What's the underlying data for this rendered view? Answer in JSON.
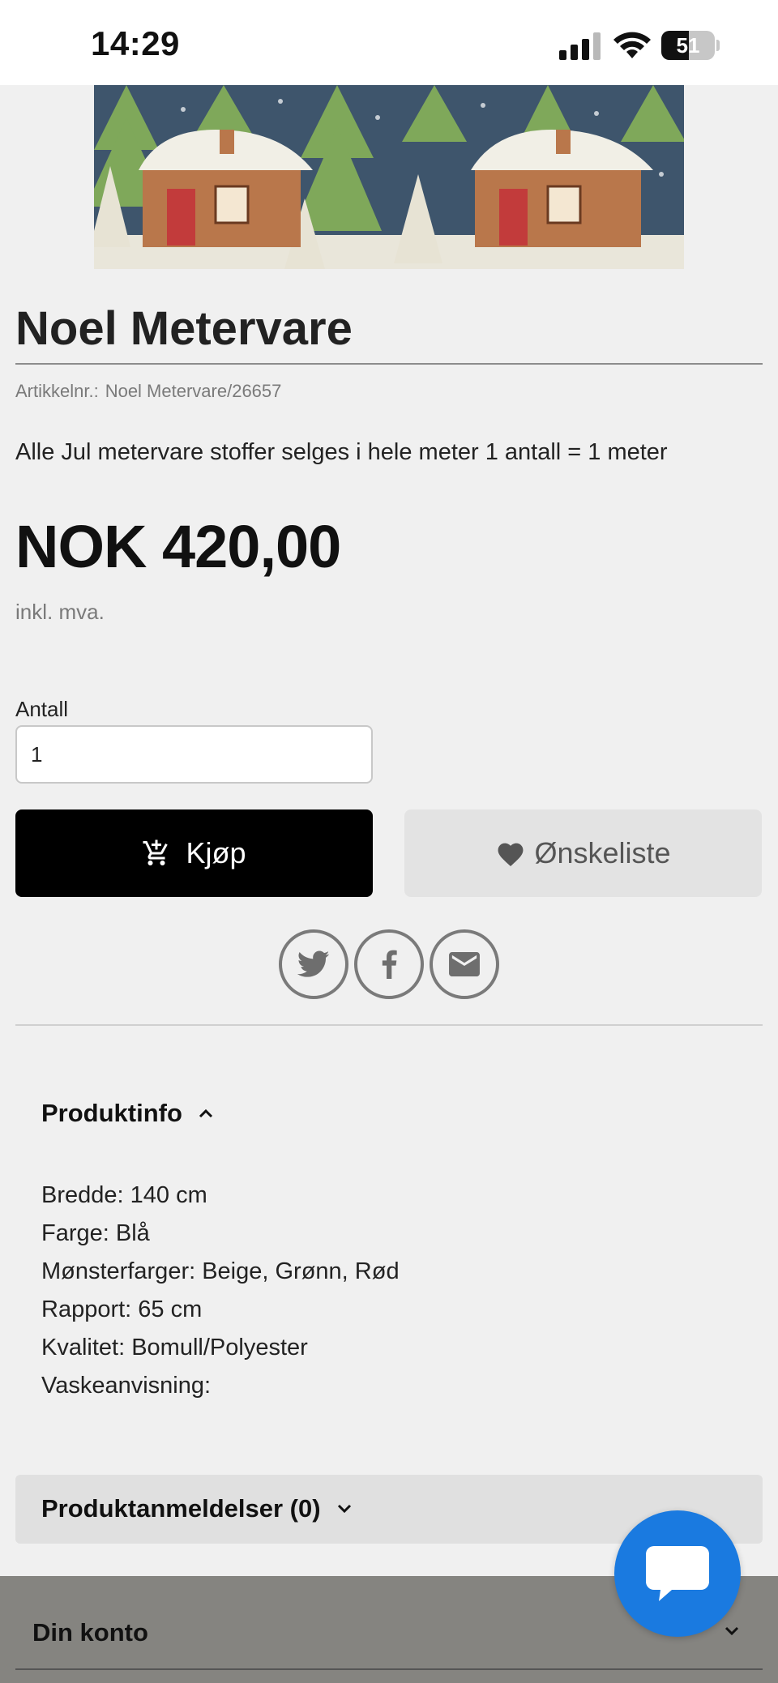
{
  "status_bar": {
    "time": "14:29",
    "battery": "51",
    "battery_level": 0.51
  },
  "product": {
    "title": "Noel Metervare",
    "sku_label": "Artikkelnr.:",
    "sku_value": "Noel Metervare/26657",
    "description": "Alle Jul metervare stoffer selges i hele meter 1 antall = 1 meter",
    "price": "NOK 420,00",
    "vat_note": "inkl. mva."
  },
  "purchase": {
    "quantity_label": "Antall",
    "quantity_value": "1",
    "buy_label": "Kjøp",
    "wishlist_label": "Ønskeliste"
  },
  "share": {
    "icons": [
      "twitter-icon",
      "facebook-icon",
      "email-icon"
    ]
  },
  "product_info": {
    "heading": "Produktinfo",
    "lines": [
      "Bredde: 140 cm",
      "Farge: Blå",
      "Mønsterfarger: Beige, Grønn, Rød",
      "Rapport: 65 cm",
      "Kvalitet: Bomull/Polyester",
      "Vaskeanvisning:"
    ]
  },
  "reviews": {
    "heading": "Produktanmeldelser (0)"
  },
  "footer": {
    "account_label": "Din konto"
  },
  "colors": {
    "buy_button": "#000000",
    "wishlist_button": "#e3e3e3",
    "chat_button": "#1a7ae0",
    "footer_bg": "#858480",
    "page_bg": "#f0f0f0"
  }
}
